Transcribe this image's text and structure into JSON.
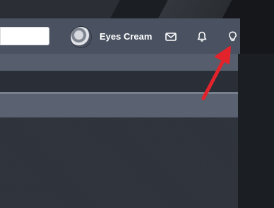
{
  "header": {
    "username": "Eyes Cream",
    "avatar": "user-avatar",
    "icons": {
      "mail": "envelope-icon",
      "notifications": "bell-icon",
      "tips": "lightbulb-icon"
    }
  },
  "annotation": {
    "color": "#e3232c",
    "points_to": "lightbulb-icon"
  },
  "colors": {
    "topbar": "#4a5261",
    "panel_header": "#5a6271",
    "panel_body": "#2d323b"
  }
}
